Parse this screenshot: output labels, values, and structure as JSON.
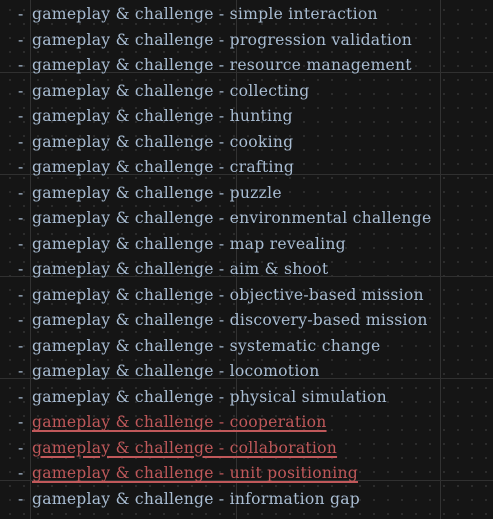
{
  "items": [
    {
      "bullet": "-",
      "text": "gameplay & challenge - simple interaction",
      "highlighted": false
    },
    {
      "bullet": "-",
      "text": "gameplay & challenge - progression validation",
      "highlighted": false
    },
    {
      "bullet": "-",
      "text": "gameplay & challenge - resource management",
      "highlighted": false
    },
    {
      "bullet": "-",
      "text": "gameplay & challenge - collecting",
      "highlighted": false
    },
    {
      "bullet": "-",
      "text": "gameplay & challenge - hunting",
      "highlighted": false
    },
    {
      "bullet": "-",
      "text": "gameplay & challenge - cooking",
      "highlighted": false
    },
    {
      "bullet": "-",
      "text": "gameplay & challenge - crafting",
      "highlighted": false
    },
    {
      "bullet": "-",
      "text": "gameplay & challenge - puzzle",
      "highlighted": false
    },
    {
      "bullet": "-",
      "text": "gameplay & challenge - environmental challenge",
      "highlighted": false
    },
    {
      "bullet": "-",
      "text": "gameplay & challenge - map revealing",
      "highlighted": false
    },
    {
      "bullet": "-",
      "text": "gameplay & challenge - aim & shoot",
      "highlighted": false
    },
    {
      "bullet": "-",
      "text": "gameplay & challenge - objective-based mission",
      "highlighted": false
    },
    {
      "bullet": "-",
      "text": "gameplay & challenge - discovery-based mission",
      "highlighted": false
    },
    {
      "bullet": "-",
      "text": "gameplay & challenge - systematic change",
      "highlighted": false
    },
    {
      "bullet": "-",
      "text": "gameplay & challenge - locomotion",
      "highlighted": false
    },
    {
      "bullet": "-",
      "text": "gameplay & challenge - physical simulation",
      "highlighted": false
    },
    {
      "bullet": "-",
      "text": "gameplay & challenge - cooperation",
      "highlighted": true
    },
    {
      "bullet": "-",
      "text": "gameplay & challenge - collaboration",
      "highlighted": true
    },
    {
      "bullet": "-",
      "text": "gameplay & challenge - unit positioning",
      "highlighted": true
    },
    {
      "bullet": "-",
      "text": "gameplay & challenge - information gap",
      "highlighted": false
    }
  ],
  "colors": {
    "background": "#151515",
    "text": "#a9bdd3",
    "highlight": "#c0585a"
  }
}
